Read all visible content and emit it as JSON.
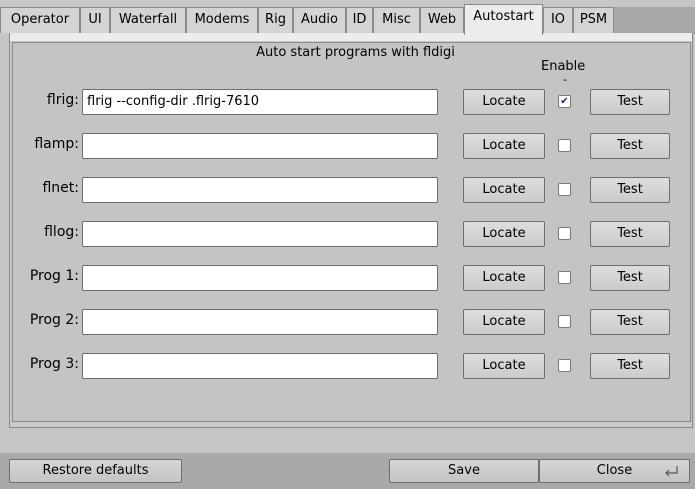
{
  "tabs": [
    {
      "label": "Operator"
    },
    {
      "label": "UI"
    },
    {
      "label": "Waterfall"
    },
    {
      "label": "Modems"
    },
    {
      "label": "Rig"
    },
    {
      "label": "Audio"
    },
    {
      "label": "ID"
    },
    {
      "label": "Misc"
    },
    {
      "label": "Web"
    },
    {
      "label": "Autostart",
      "active": true
    },
    {
      "label": "IO"
    },
    {
      "label": "PSM"
    }
  ],
  "autostart": {
    "heading": "Auto start programs with fldigi",
    "enable_label": "Enable",
    "enable_dash": "-",
    "locate_label": "Locate",
    "test_label": "Test",
    "rows": [
      {
        "label": "flrig:",
        "value": "flrig --config-dir .flrig-7610",
        "enabled": true
      },
      {
        "label": "flamp:",
        "value": "",
        "enabled": false
      },
      {
        "label": "flnet:",
        "value": "",
        "enabled": false
      },
      {
        "label": "fllog:",
        "value": "",
        "enabled": false
      },
      {
        "label": "Prog 1:",
        "value": "",
        "enabled": false
      },
      {
        "label": "Prog 2:",
        "value": "",
        "enabled": false
      },
      {
        "label": "Prog 3:",
        "value": "",
        "enabled": false
      }
    ]
  },
  "footer": {
    "restore_label": "Restore defaults",
    "save_label": "Save",
    "close_label": "Close"
  },
  "icons": {
    "checkmark": "checkmark-icon",
    "close_return": "return-arrow-icon"
  }
}
